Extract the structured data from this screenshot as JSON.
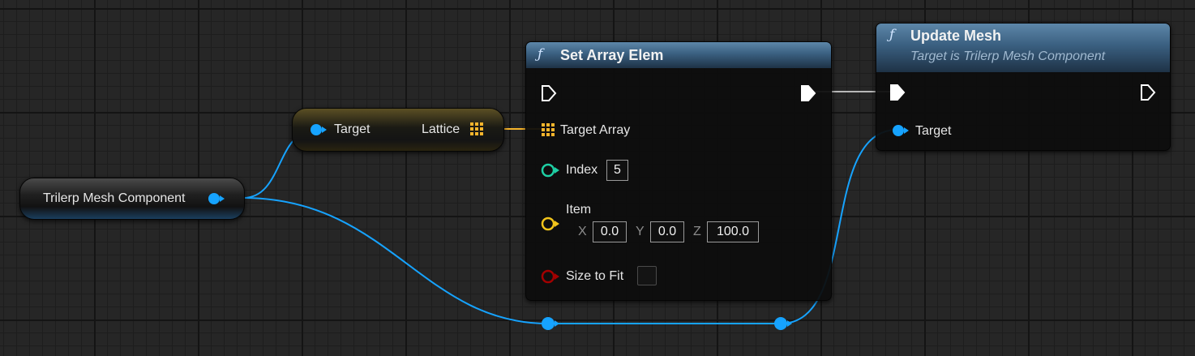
{
  "colors": {
    "object_pin": "#16a3ff",
    "array_pin": "#f7b52c",
    "int_pin": "#1ecfa4",
    "vector_pin": "#f2c41b",
    "bool_pin": "#a20000",
    "exec_pin": "#ffffff",
    "header_blue": "#3a5f80",
    "graph_bg": "#262626"
  },
  "nodes": {
    "trilerp": {
      "label": "Trilerp Mesh Component"
    },
    "get_lattice": {
      "target_label": "Target",
      "output_label": "Lattice"
    },
    "set_array": {
      "function_icon": "ƒ",
      "title": "Set Array Elem",
      "target_array_label": "Target Array",
      "index_label": "Index",
      "index_value": "5",
      "item_label": "Item",
      "item_x_label": "X",
      "item_x": "0.0",
      "item_y_label": "Y",
      "item_y": "0.0",
      "item_z_label": "Z",
      "item_z": "100.0",
      "size_to_fit_label": "Size to Fit",
      "size_to_fit_checked": false
    },
    "update_mesh": {
      "function_icon": "ƒ",
      "title": "Update Mesh",
      "subtitle": "Target is Trilerp Mesh Component",
      "target_label": "Target"
    }
  }
}
